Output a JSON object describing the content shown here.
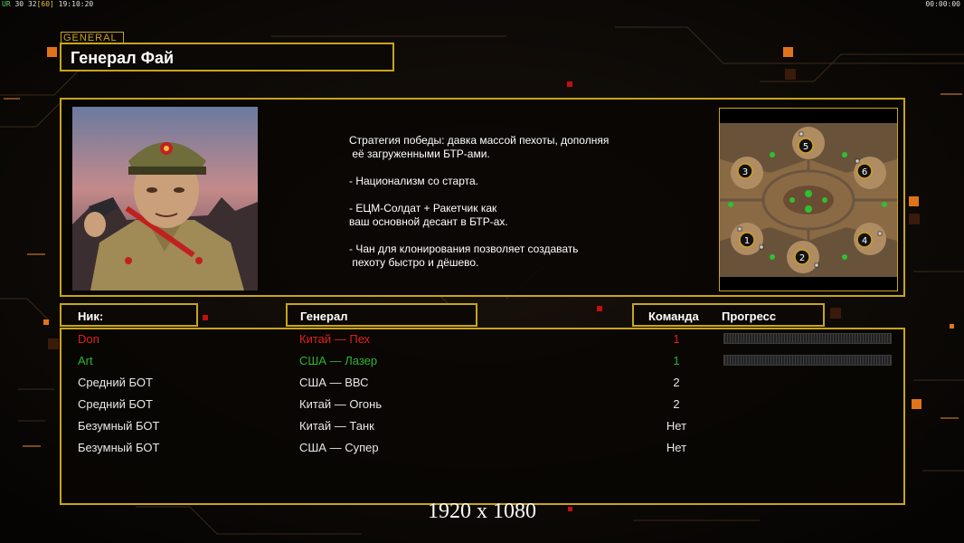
{
  "hud": {
    "left_prefix": "UR",
    "left_a": "30",
    "left_b": "32",
    "left_c": "[60]",
    "left_time": "19:10:20",
    "right_time": "00:00:00"
  },
  "tag": "GENERAL",
  "title": "Генерал Фай",
  "description": "Стратегия победы: давка массой пехоты, дополняя\n её загруженными БТР-ами.\n\n- Национализм со старта.\n\n- ЕЦМ-Солдат + Ракетчик как\nваш основной десант в БТР-ах.\n\n- Чан для клонирования позволяет создавать\n пехоту быстро и дёшево.",
  "minimap_slots": [
    "1",
    "2",
    "3",
    "4",
    "5",
    "6"
  ],
  "headers": {
    "nick": "Ник:",
    "general": "Генерал",
    "team": "Команда",
    "progress": "Прогресс"
  },
  "players": [
    {
      "name": "Don",
      "general": "Китай — Пех",
      "team": "1",
      "color": "#e02020",
      "progress": true
    },
    {
      "name": "Art",
      "general": "США — Лазер",
      "team": "1",
      "color": "#2fb52f",
      "progress": true
    },
    {
      "name": "Средний БОТ",
      "general": "США — ВВС",
      "team": "2",
      "color": "#f0f0f0",
      "progress": false
    },
    {
      "name": "Средний БОТ",
      "general": "Китай — Огонь",
      "team": "2",
      "color": "#f0f0f0",
      "progress": false
    },
    {
      "name": "Безумный БОТ",
      "general": "Китай — Танк",
      "team": "Нет",
      "color": "#f0f0f0",
      "progress": false
    },
    {
      "name": "Безумный БОТ",
      "general": "США — Супер",
      "team": "Нет",
      "color": "#f0f0f0",
      "progress": false
    }
  ],
  "resolution": "1920 x 1080"
}
